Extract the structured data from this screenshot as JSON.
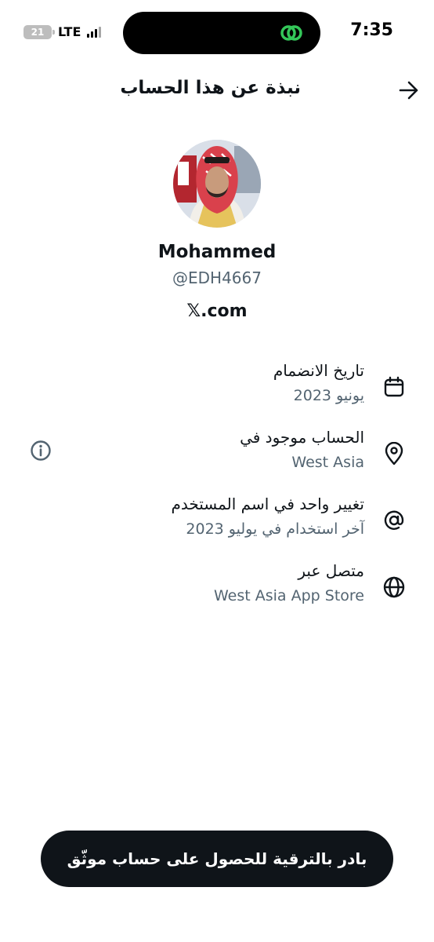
{
  "status_bar": {
    "time": "7:35",
    "battery_level": "21",
    "network": "LTE"
  },
  "header": {
    "title": "نبذة عن هذا الحساب",
    "back_icon": "arrow-right-icon"
  },
  "profile": {
    "display_name": "Mohammed",
    "handle": "@EDH4667",
    "site": "𝕏.com"
  },
  "info_rows": [
    {
      "title": "تاريخ الانضمام",
      "subtitle": "يونيو 2023",
      "icon": "calendar-icon"
    },
    {
      "title": "الحساب موجود في",
      "subtitle": "West Asia",
      "icon": "location-pin-icon"
    },
    {
      "title": "تغيير واحد في اسم المستخدم",
      "subtitle": "آخر استخدام في يوليو 2023",
      "icon": "at-sign-icon"
    },
    {
      "title": "متصل عبر",
      "subtitle": "West Asia App Store",
      "icon": "globe-icon"
    }
  ],
  "upgrade_button": {
    "label": "بادر بالترقية للحصول على حساب موثّق"
  },
  "colors": {
    "primary_text": "#0f1419",
    "secondary_text": "#536471",
    "button_bg": "#0f1419",
    "island_accent": "#34c759"
  }
}
